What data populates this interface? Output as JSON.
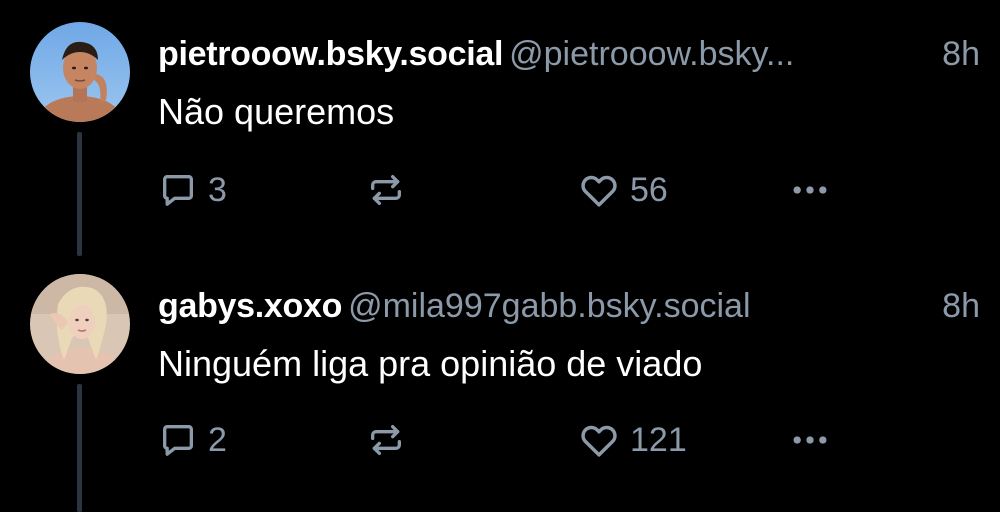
{
  "posts": [
    {
      "display_name": "pietrooow.bsky.social",
      "handle": "@pietrooow.bsky...",
      "timestamp": "8h",
      "text": "Não queremos",
      "reply_count": "3",
      "like_count": "56",
      "avatar_icon": "profile-photo"
    },
    {
      "display_name": "gabys.xoxo",
      "handle": "@mila997gabb.bsky.social",
      "timestamp": "8h",
      "text": "Ninguém liga pra opinião de viado",
      "reply_count": "2",
      "like_count": "121",
      "avatar_icon": "profile-photo"
    }
  ],
  "icons": {
    "reply": "speech-bubble-icon",
    "repost": "repost-arrows-icon",
    "like": "heart-icon",
    "more": "ellipsis-icon"
  },
  "colors": {
    "background": "#000000",
    "text_primary": "#ffffff",
    "text_secondary": "#8b99a8",
    "thread_line": "#2b3440"
  }
}
